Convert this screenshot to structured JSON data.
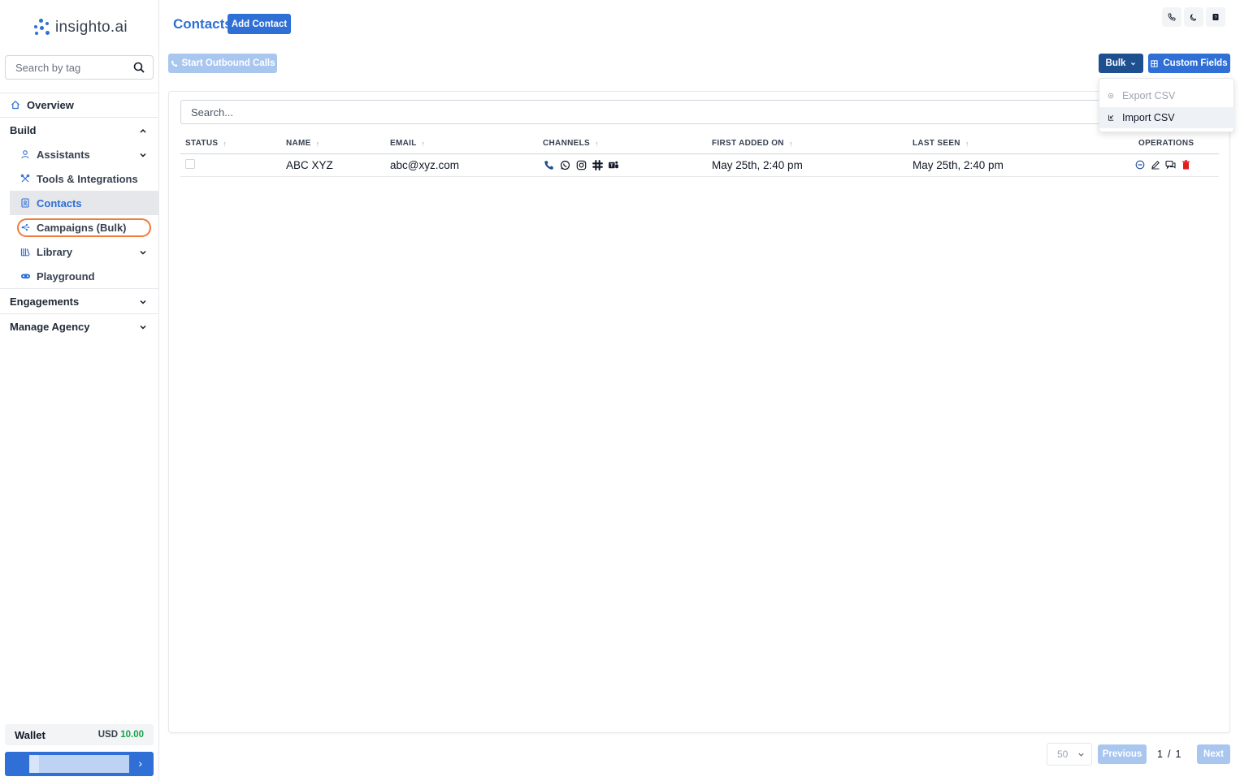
{
  "brand": {
    "name": "insighto.ai",
    "accent": "#2f6fd6"
  },
  "sidebar": {
    "search_placeholder": "Search by tag",
    "overview": "Overview",
    "build": "Build",
    "assistants": "Assistants",
    "tools": "Tools & Integrations",
    "contacts": "Contacts",
    "campaigns": "Campaigns (Bulk)",
    "library": "Library",
    "playground": "Playground",
    "engagements": "Engagements",
    "manage_agency": "Manage Agency",
    "wallet_label": "Wallet",
    "wallet_currency": "USD",
    "wallet_amount": "10.00"
  },
  "header": {
    "title": "Contacts",
    "add_contact": "Add Contact",
    "start_outbound": "Start Outbound Calls",
    "bulk": "Bulk",
    "custom_fields": "Custom Fields"
  },
  "bulk_menu": {
    "export": "Export CSV",
    "import": "Import CSV"
  },
  "table": {
    "search_placeholder": "Search...",
    "columns": [
      "STATUS",
      "NAME",
      "EMAIL",
      "CHANNELS",
      "FIRST ADDED ON",
      "LAST SEEN",
      "OPERATIONS"
    ],
    "rows": [
      {
        "name": "ABC XYZ",
        "email": "abc@xyz.com",
        "first_added": "May 25th, 2:40 pm",
        "last_seen": "May 25th, 2:40 pm",
        "channels": [
          "phone-icon",
          "whatsapp-icon",
          "instagram-icon",
          "slack-icon",
          "teams-icon"
        ]
      }
    ]
  },
  "pagination": {
    "page_size": "50",
    "previous": "Previous",
    "current": "1",
    "separator": "/",
    "total": "1",
    "next": "Next"
  }
}
